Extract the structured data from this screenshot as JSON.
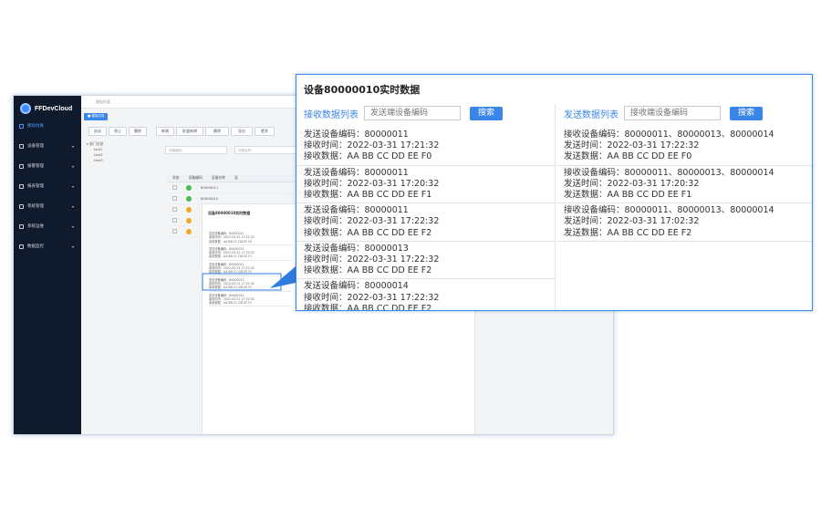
{
  "app": {
    "brand": "FFDevCloud",
    "breadcrumb": "模拟仿真",
    "tag": "■ 模拟仿真",
    "sidebar": [
      {
        "label": "模拟仿真",
        "active": true
      },
      {
        "label": "设备管理",
        "active": false
      },
      {
        "label": "报警管理",
        "active": false
      },
      {
        "label": "报表管理",
        "active": false
      },
      {
        "label": "系统管理",
        "active": false
      },
      {
        "label": "系统运维",
        "active": false
      },
      {
        "label": "数据监控",
        "active": false
      }
    ],
    "toolbar": [
      "启动",
      "停止",
      "删除",
      "新增",
      "批量新增",
      "删除",
      "导出",
      "更多"
    ],
    "filters": [
      "设备编码",
      "设备名称"
    ],
    "tree": [
      "▾ 部门总部",
      "test1",
      "test2",
      "test3"
    ],
    "grid_header": [
      "状态",
      "设备编码",
      "设备名称",
      "设"
    ],
    "grid_rows": [
      {
        "status": "ok",
        "code": "80000011"
      },
      {
        "status": "ok",
        "code": "80000012"
      },
      {
        "status": "warn",
        "code": ""
      },
      {
        "status": "warn",
        "code": ""
      },
      {
        "status": "warn",
        "code": ""
      }
    ],
    "inner_title": "设备80000010实时数据"
  },
  "popup": {
    "title": "设备80000010实时数据",
    "left": {
      "label": "接收数据列表",
      "placeholder": "发送端设备编码",
      "button": "搜索",
      "messages": [
        {
          "lines": [
            "发送设备编码：80000011",
            "接收时间：2022-03-31 17:21:32",
            "接收数据：AA BB CC DD  EE F0"
          ]
        },
        {
          "lines": [
            "发送设备编码：80000011",
            "接收时间：2022-03-31 17:20:32",
            "接收数据：AA BB CC DD  EE F1"
          ]
        },
        {
          "lines": [
            "发送设备编码：80000011",
            "接收时间：2022-03-31 17:22:32",
            "接收数据：AA BB CC DD  EE F2"
          ]
        },
        {
          "lines": [
            "发送设备编码：80000013",
            "接收时间：2022-03-31 17:22:32",
            "接收数据：AA BB CC DD  EE F2"
          ]
        },
        {
          "lines": [
            "发送设备编码：80000014",
            "接收时间：2022-03-31 17:22:32",
            "接收数据：AA BB CC DD  EE F2"
          ]
        }
      ]
    },
    "right": {
      "label": "发送数据列表",
      "placeholder": "接收端设备编码",
      "button": "搜索",
      "messages": [
        {
          "lines": [
            "接收设备编码：80000011、80000013、80000014",
            "发送时间：2022-03-31 17:22:32",
            "发送数据：AA BB CC DD  EE F0"
          ]
        },
        {
          "lines": [
            "接收设备编码：80000011、80000013、80000014",
            "发送时间：2022-03-31 17:20:32",
            "发送数据：AA BB CC DD  EE F1"
          ]
        },
        {
          "lines": [
            "接收设备编码：80000011、80000013、80000014",
            "发送时间：2022-03-31 17:02:32",
            "发送数据：AA BB CC DD  EE F2"
          ]
        }
      ]
    }
  },
  "colors": {
    "accent": "#3a86e8",
    "sidebar": "#0f1b2d",
    "ok": "#3fbf55",
    "warn": "#f2a62a"
  }
}
